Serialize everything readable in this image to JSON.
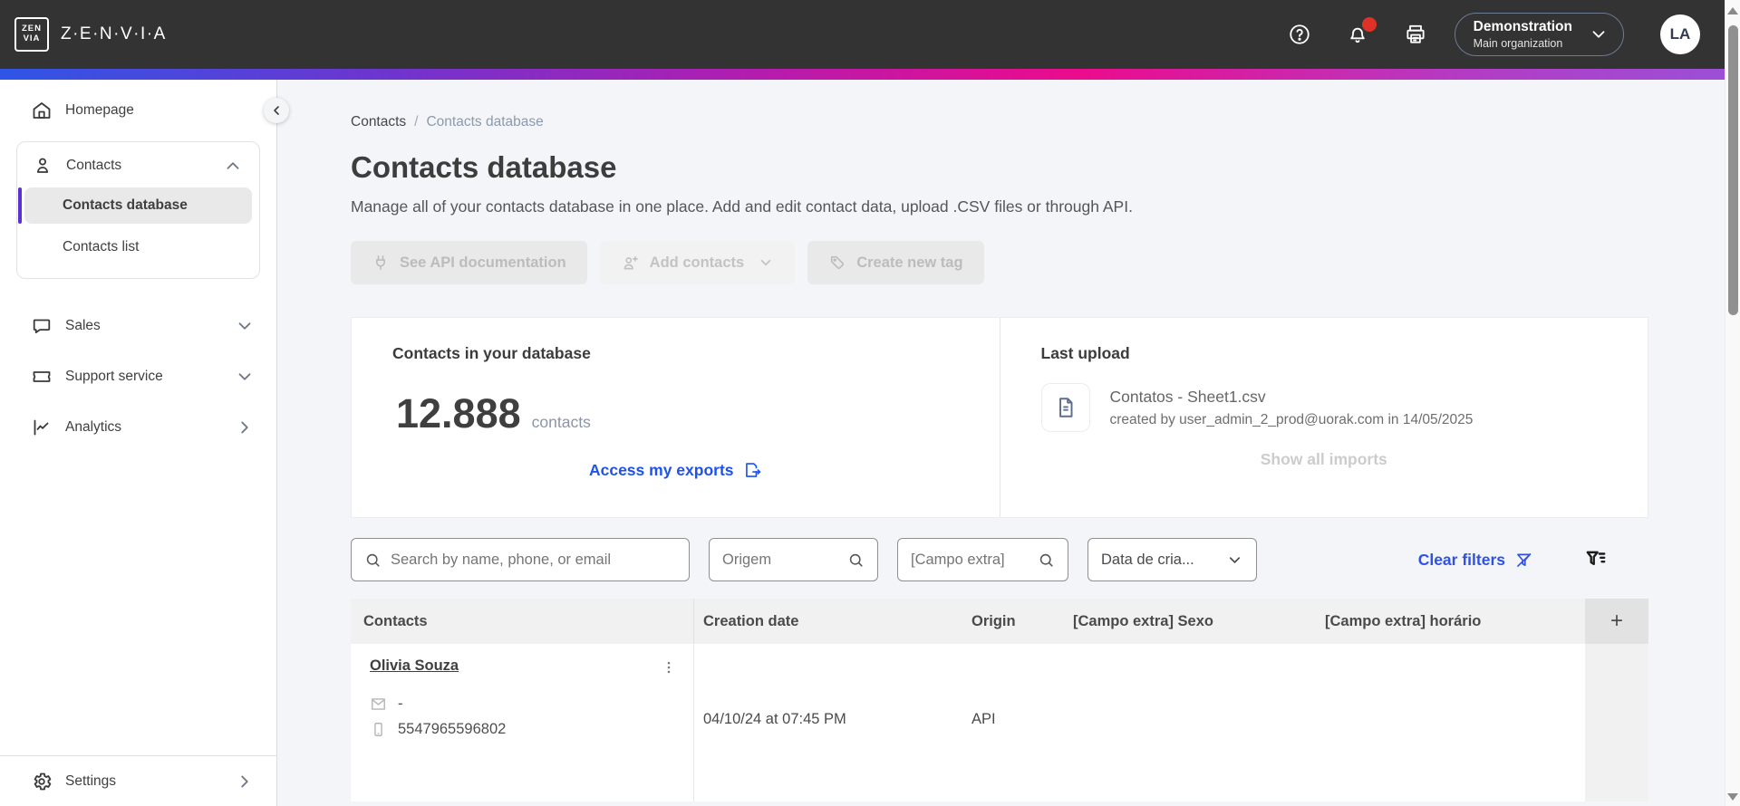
{
  "topbar": {
    "logo_top": "ZEN",
    "logo_bottom": "VIA",
    "brand": "Z·E·N·V·I·A",
    "org": {
      "name": "Demonstration",
      "sub": "Main organization"
    },
    "avatar_initials": "LA"
  },
  "sidebar": {
    "homepage": "Homepage",
    "contacts_group": {
      "label": "Contacts",
      "items": [
        {
          "label": "Contacts database"
        },
        {
          "label": "Contacts list"
        }
      ]
    },
    "sales": "Sales",
    "support": "Support service",
    "analytics": "Analytics",
    "settings": "Settings"
  },
  "breadcrumb": {
    "parent": "Contacts",
    "separator": "/",
    "current": "Contacts database"
  },
  "page": {
    "title": "Contacts database",
    "subtitle": "Manage all of your contacts database in one place. Add and edit contact data, upload .CSV files or through API."
  },
  "actions": {
    "see_api": "See API documentation",
    "add_contacts": "Add contacts",
    "create_tag": "Create new tag"
  },
  "database_card": {
    "heading": "Contacts in your database",
    "count": "12.888",
    "unit": "contacts",
    "exports_link": "Access my exports"
  },
  "upload_card": {
    "heading": "Last upload",
    "file_name": "Contatos - Sheet1.csv",
    "file_meta": "created by user_admin_2_prod@uorak.com in 14/05/2025",
    "show_all_link": "Show all imports"
  },
  "filters": {
    "search_placeholder": "Search by name, phone, or email",
    "origem_placeholder": "Origem",
    "campo_extra_placeholder": "[Campo extra]",
    "date_label": "Data de cria...",
    "clear_label": "Clear filters"
  },
  "table": {
    "columns": [
      "Contacts",
      "Creation date",
      "Origin",
      "[Campo extra] Sexo",
      "[Campo extra] horário"
    ],
    "add_column_label": "+",
    "rows": [
      {
        "name": "Olivia Souza",
        "email": "-",
        "phone": "5547965596802",
        "creation_date": "04/10/24 at 07:45 PM",
        "origin": "API"
      }
    ]
  },
  "colors": {
    "topbar_bg": "#333333",
    "accent_blue": "#1d52ef",
    "active_purple": "#5b30d6",
    "notification_red": "#df3226",
    "gradient_start": "#2f55e6",
    "gradient_mid": "#ec0b8c",
    "gradient_end": "#9a50d8"
  }
}
